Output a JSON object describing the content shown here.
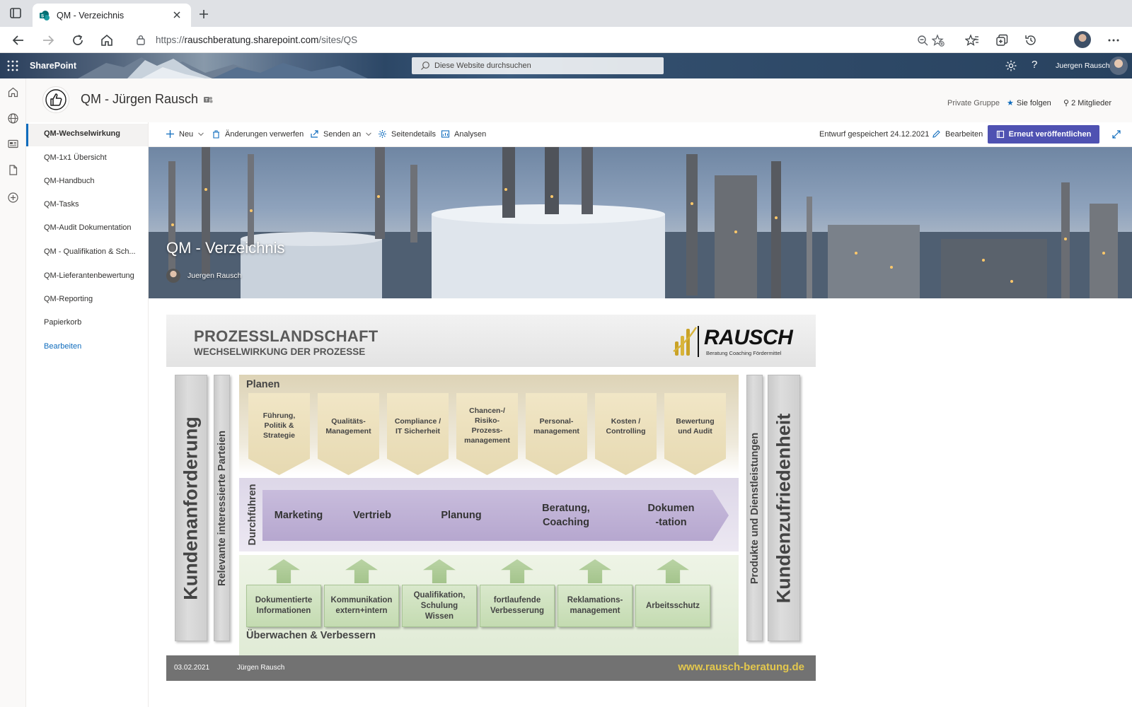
{
  "browser": {
    "tab_title": "QM - Verzeichnis",
    "url_prefix": "https://",
    "url_domain": "rauschberatung.sharepoint.com",
    "url_path": "/sites/QS"
  },
  "suite": {
    "brand": "SharePoint",
    "search_placeholder": "Diese Website durchsuchen",
    "user_name": "Juergen Rausch",
    "help_label": "?"
  },
  "site": {
    "title": "QM - Jürgen Rausch",
    "privacy": "Private Gruppe",
    "follow_label": "Sie folgen",
    "members_label": "2 Mitglieder"
  },
  "nav": {
    "items": [
      {
        "label": "QM-Wechselwirkung"
      },
      {
        "label": "QM-1x1 Übersicht"
      },
      {
        "label": "QM-Handbuch"
      },
      {
        "label": "QM-Tasks"
      },
      {
        "label": "QM-Audit Dokumentation"
      },
      {
        "label": "QM - Qualifikation & Sch..."
      },
      {
        "label": "QM-Lieferantenbewertung"
      },
      {
        "label": "QM-Reporting"
      },
      {
        "label": "Papierkorb"
      }
    ],
    "edit_label": "Bearbeiten"
  },
  "commandbar": {
    "new_label": "Neu",
    "discard_label": "Änderungen verwerfen",
    "send_label": "Senden an",
    "details_label": "Seitendetails",
    "analytics_label": "Analysen",
    "saved_status": "Entwurf gespeichert 24.12.2021",
    "edit_label": "Bearbeiten",
    "republish_label": "Erneut veröffentlichen"
  },
  "hero": {
    "title": "QM - Verzeichnis",
    "author": "Juergen Rausch"
  },
  "diagram": {
    "title": "PROZESSLANDSCHAFT",
    "subtitle": "WECHSELWIRKUNG DER PROZESSE",
    "logo_name": "RAUSCH",
    "logo_tagline": "Beratung Coaching Fördermittel",
    "left_outer": "Kundenanforderung",
    "left_inner": "Relevante interessierte Parteien",
    "right_inner": "Produkte und Dienstleistungen",
    "right_outer": "Kundenzufriedenheit",
    "plan_label": "Planen",
    "plan_items": [
      "Führung,\nPolitik &\nStrategie",
      "Qualitäts-\nManagement",
      "Compliance /\nIT Sicherheit",
      "Chancen-/\nRisiko-\nProzess-\nmanagement",
      "Personal-\nmanagement",
      "Kosten /\nControlling",
      "Bewertung\nund Audit"
    ],
    "do_label": "Durchführen",
    "do_items": [
      "Marketing",
      "Vertrieb",
      "Planung",
      "Beratung,\nCoaching",
      "Dokumen\n-tation"
    ],
    "check_label": "Überwachen & Verbessern",
    "check_items": [
      "Dokumentierte\nInformationen",
      "Kommunikation\nextern+intern",
      "Qualifikation,\nSchulung\nWissen",
      "fortlaufende\nVerbesserung",
      "Reklamations-\nmanagement",
      "Arbeitsschutz"
    ],
    "footer_date": "03.02.2021",
    "footer_author": "Jürgen Rausch",
    "footer_web": "www.rausch-beratung.de"
  },
  "colors": {
    "accent": "#0f6cbd",
    "publish_button": "#4f52b2",
    "plan_band": "#e6d9b1",
    "do_band": "#b6a7cf",
    "check_band": "#c4dbb1"
  }
}
